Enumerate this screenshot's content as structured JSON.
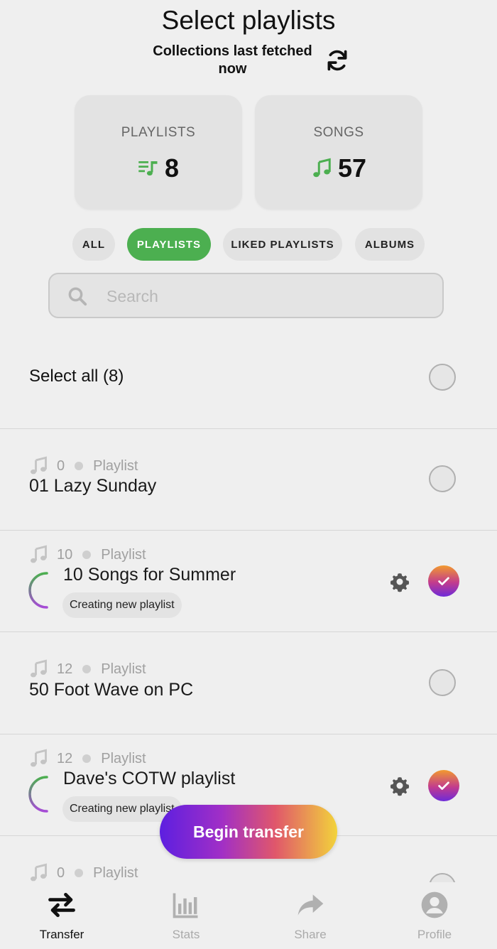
{
  "header": {
    "title": "Select playlists",
    "fetched_label": "Collections last fetched now"
  },
  "stats": {
    "playlists": {
      "label": "PLAYLISTS",
      "value": "8"
    },
    "songs": {
      "label": "SONGS",
      "value": "57"
    }
  },
  "filters": {
    "all": "ALL",
    "playlists": "PLAYLISTS",
    "liked": "LIKED PLAYLISTS",
    "albums": "ALBUMS",
    "active": "PLAYLISTS"
  },
  "search": {
    "placeholder": "Search",
    "value": ""
  },
  "select_all": {
    "label": "Select all (8)"
  },
  "rows": [
    {
      "count": "0",
      "type": "Playlist",
      "title": "01 Lazy Sunday",
      "selected": false,
      "status": ""
    },
    {
      "count": "10",
      "type": "Playlist",
      "title": "10 Songs for Summer",
      "selected": true,
      "status": "Creating new playlist"
    },
    {
      "count": "12",
      "type": "Playlist",
      "title": "50 Foot Wave on PC",
      "selected": false,
      "status": ""
    },
    {
      "count": "12",
      "type": "Playlist",
      "title": "Dave's COTW playlist",
      "selected": true,
      "status": "Creating new playlist"
    },
    {
      "count": "0",
      "type": "Playlist",
      "title": "",
      "selected": false,
      "status": ""
    }
  ],
  "action": {
    "begin_transfer": "Begin transfer"
  },
  "nav": {
    "transfer": "Transfer",
    "stats": "Stats",
    "share": "Share",
    "profile": "Profile",
    "active": "Transfer"
  },
  "colors": {
    "accent_green": "#4caf50",
    "background": "#efefef"
  }
}
